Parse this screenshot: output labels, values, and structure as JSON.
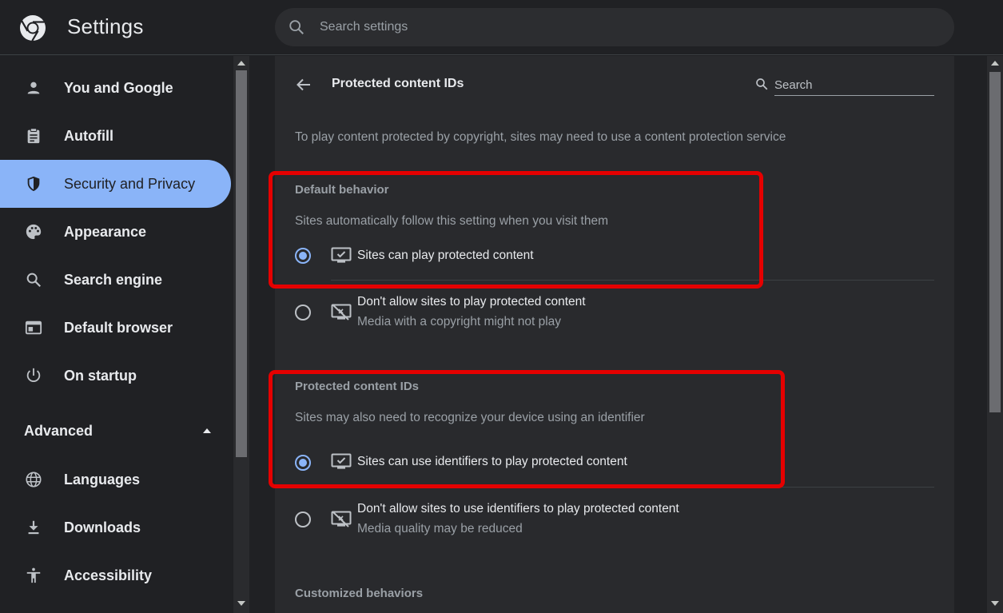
{
  "header": {
    "app_title": "Settings",
    "logo_icon": "chrome-logo-icon",
    "search_placeholder": "Search settings"
  },
  "sidebar": {
    "items": [
      {
        "label": "You and Google",
        "icon": "person-icon"
      },
      {
        "label": "Autofill",
        "icon": "clipboard-icon"
      },
      {
        "label": "Security and Privacy",
        "icon": "shield-icon",
        "active": true
      },
      {
        "label": "Appearance",
        "icon": "palette-icon"
      },
      {
        "label": "Search engine",
        "icon": "search-icon"
      },
      {
        "label": "Default browser",
        "icon": "browser-window-icon"
      },
      {
        "label": "On startup",
        "icon": "power-icon"
      }
    ],
    "advanced_label": "Advanced",
    "advanced_items": [
      {
        "label": "Languages",
        "icon": "globe-icon"
      },
      {
        "label": "Downloads",
        "icon": "download-icon"
      },
      {
        "label": "Accessibility",
        "icon": "accessibility-icon"
      }
    ]
  },
  "main": {
    "title": "Protected content IDs",
    "search_placeholder": "Search",
    "description": "To play content protected by copyright, sites may need to use a content protection service",
    "default_behavior": {
      "heading": "Default behavior",
      "subtitle": "Sites automatically follow this setting when you visit them",
      "options": [
        {
          "label": "Sites can play protected content",
          "sub": "",
          "selected": true,
          "icon": "monitor-check-icon"
        },
        {
          "label": "Don't allow sites to play protected content",
          "sub": "Media with a copyright might not play",
          "selected": false,
          "icon": "monitor-off-icon"
        }
      ]
    },
    "protected_ids": {
      "heading": "Protected content IDs",
      "subtitle": "Sites may also need to recognize your device using an identifier",
      "options": [
        {
          "label": "Sites can use identifiers to play protected content",
          "sub": "",
          "selected": true,
          "icon": "monitor-check-icon"
        },
        {
          "label": "Don't allow sites to use identifiers to play protected content",
          "sub": "Media quality may be reduced",
          "selected": false,
          "icon": "monitor-off-icon"
        }
      ]
    },
    "customized_heading": "Customized behaviors"
  },
  "colors": {
    "accent": "#8ab4f8",
    "highlight": "#e50000",
    "background": "#202124",
    "card": "#292a2d"
  }
}
